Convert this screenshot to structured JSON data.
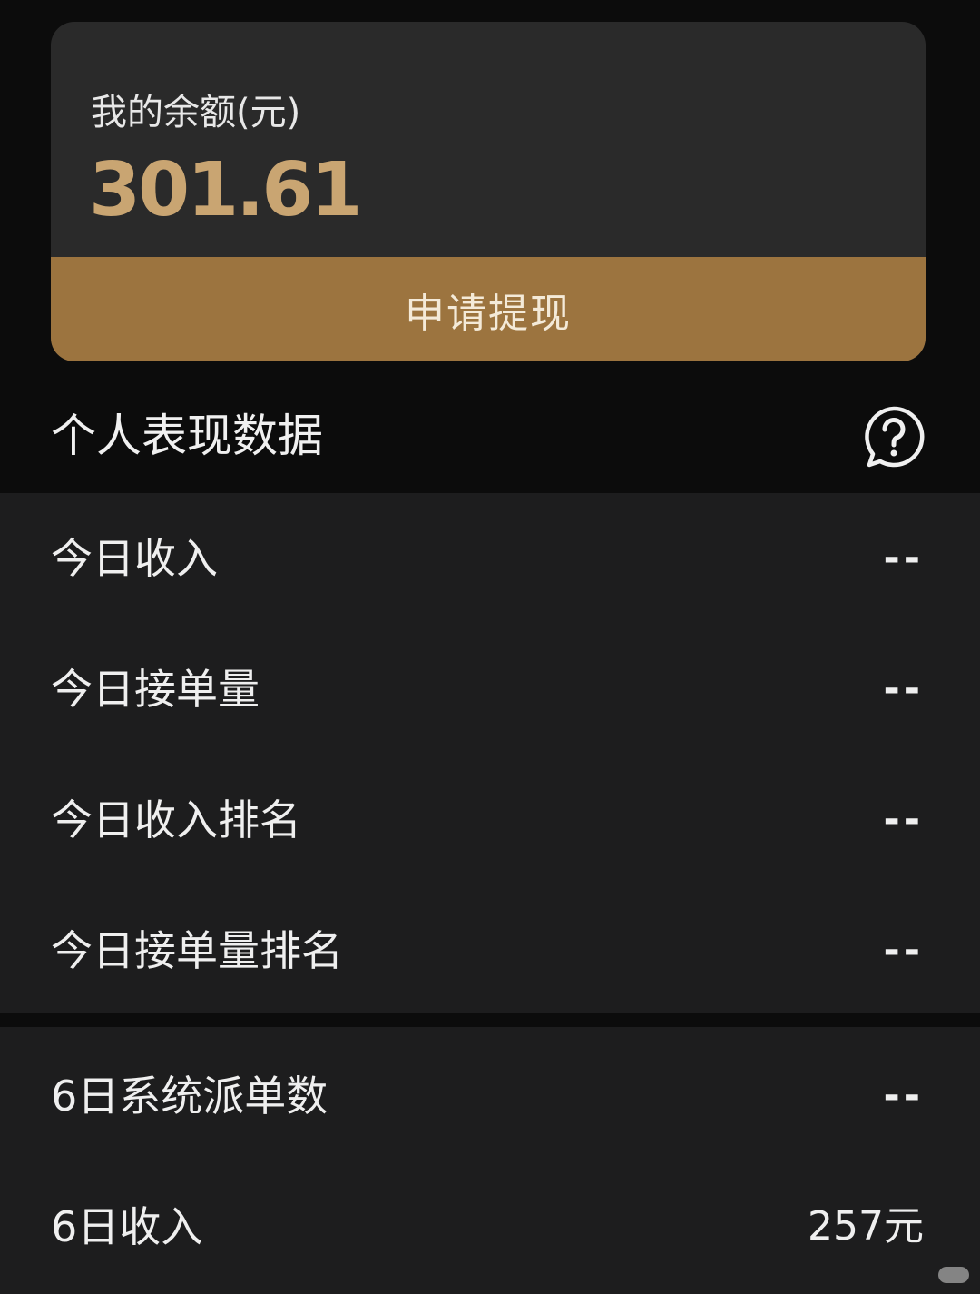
{
  "balance": {
    "label": "我的余额(元)",
    "amount": "301.61",
    "withdraw_label": "申请提现"
  },
  "section": {
    "title": "个人表现数据",
    "help_icon": "question-bubble-icon"
  },
  "stats_today": [
    {
      "label": "今日收入",
      "value": "--"
    },
    {
      "label": "今日接单量",
      "value": "--"
    },
    {
      "label": "今日收入排名",
      "value": "--"
    },
    {
      "label": "今日接单量排名",
      "value": "--"
    }
  ],
  "stats_day6": [
    {
      "label": "6日系统派单数",
      "value": "--"
    },
    {
      "label": "6日收入",
      "value": "257元"
    }
  ],
  "colors": {
    "accent_gold": "#9c743f",
    "amount_gold": "#c9a572",
    "card_bg": "#2a2a2a",
    "page_bg": "#0c0c0c",
    "row_bg": "#1d1d1e"
  }
}
